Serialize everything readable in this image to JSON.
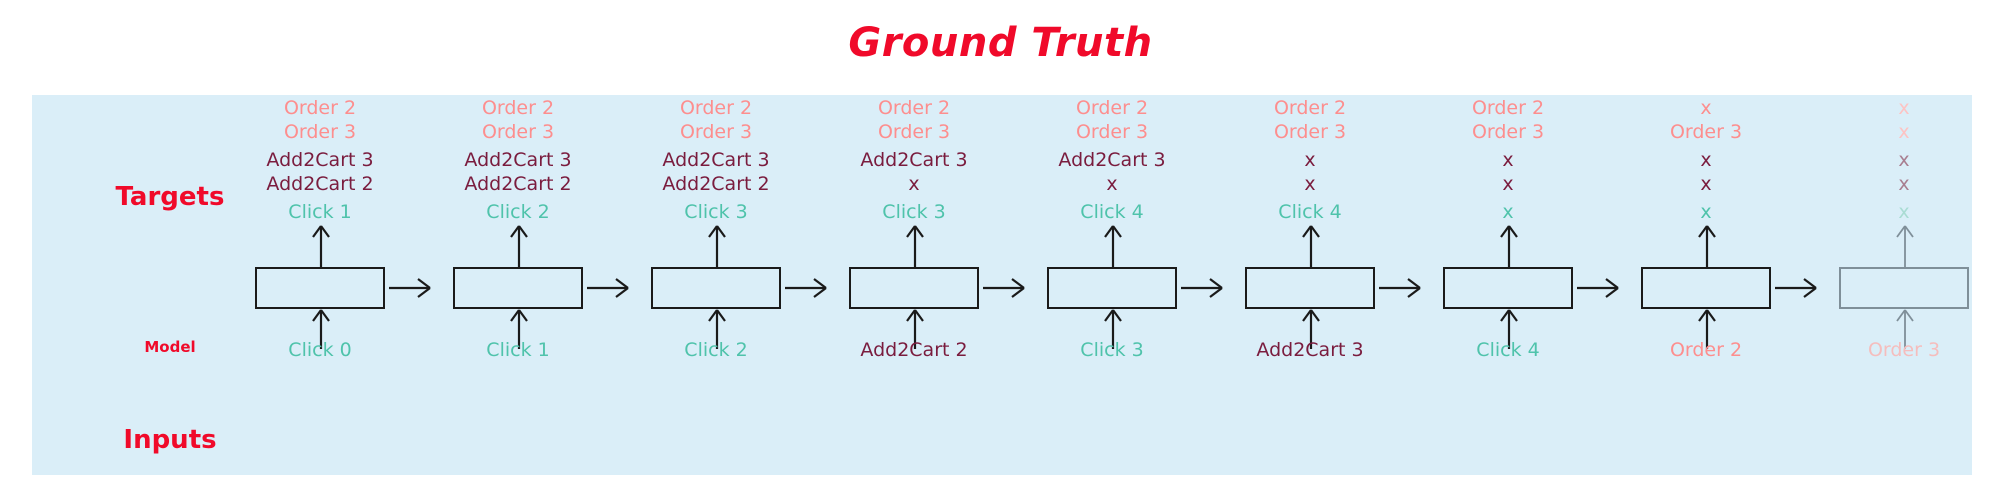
{
  "title": "Ground Truth",
  "labels": {
    "targets": "Targets",
    "model": "Model",
    "inputs": "Inputs"
  },
  "colors": {
    "title": "#f00a2a",
    "panel_background": "#daeef8",
    "order_text": "#fd8e8e",
    "add2cart_text": "#7a1c3e",
    "click_text": "#4fc3ab",
    "box_border": "#1a1a1a",
    "faded_box_border": "#7f8f99",
    "label": "#f00a2a"
  },
  "columns": [
    {
      "index": 1,
      "faded": false,
      "targets": {
        "order1": "Order 2",
        "order2": "Order 3",
        "cart1": "Add2Cart 3",
        "cart2": "Add2Cart 2",
        "click": "Click 1"
      },
      "input": "Click 0"
    },
    {
      "index": 2,
      "faded": false,
      "targets": {
        "order1": "Order 2",
        "order2": "Order 3",
        "cart1": "Add2Cart 3",
        "cart2": "Add2Cart 2",
        "click": "Click 2"
      },
      "input": "Click 1"
    },
    {
      "index": 3,
      "faded": false,
      "targets": {
        "order1": "Order 2",
        "order2": "Order 3",
        "cart1": "Add2Cart 3",
        "cart2": "Add2Cart 2",
        "click": "Click 3"
      },
      "input": "Click 2"
    },
    {
      "index": 4,
      "faded": false,
      "targets": {
        "order1": "Order 2",
        "order2": "Order 3",
        "cart1": "Add2Cart 3",
        "cart2": "x",
        "click": "Click 3"
      },
      "input": "Add2Cart 2"
    },
    {
      "index": 5,
      "faded": false,
      "targets": {
        "order1": "Order 2",
        "order2": "Order 3",
        "cart1": "Add2Cart 3",
        "cart2": "x",
        "click": "Click 4"
      },
      "input": "Click 3"
    },
    {
      "index": 6,
      "faded": false,
      "targets": {
        "order1": "Order 2",
        "order2": "Order 3",
        "cart1": "x",
        "cart2": "x",
        "click": "Click 4"
      },
      "input": "Add2Cart 3"
    },
    {
      "index": 7,
      "faded": false,
      "targets": {
        "order1": "Order 2",
        "order2": "Order 3",
        "cart1": "x",
        "cart2": "x",
        "click": "x"
      },
      "input": "Click 4"
    },
    {
      "index": 8,
      "faded": false,
      "targets": {
        "order1": "x",
        "order2": "Order 3",
        "cart1": "x",
        "cart2": "x",
        "click": "x"
      },
      "input": "Order 2"
    },
    {
      "index": 9,
      "faded": true,
      "targets": {
        "order1": "x",
        "order2": "x",
        "cart1": "x",
        "cart2": "x",
        "click": "x"
      },
      "input": "Order 3"
    }
  ]
}
